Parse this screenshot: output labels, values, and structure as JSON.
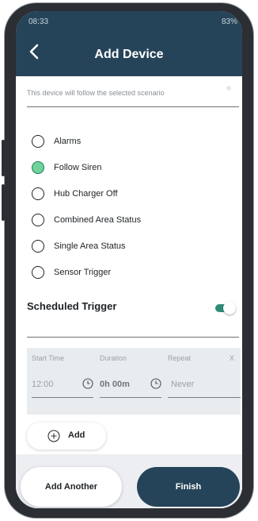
{
  "status_bar": {
    "time": "08:33",
    "right": "83%"
  },
  "header": {
    "title": "Add Device"
  },
  "hint": "This device will follow the selected scenario",
  "options": [
    {
      "label": "Alarms",
      "selected": false
    },
    {
      "label": "Follow Siren",
      "selected": true
    },
    {
      "label": "Hub Charger Off",
      "selected": false
    },
    {
      "label": "Combined Area Status",
      "selected": false
    },
    {
      "label": "Single Area Status",
      "selected": false
    },
    {
      "label": "Sensor Trigger",
      "selected": false
    }
  ],
  "scheduled": {
    "title": "Scheduled Trigger",
    "enabled": true
  },
  "schedule": {
    "start_time_label": "Start Time",
    "duration_label": "Duration",
    "repeat_label": "Repeat",
    "remove_label": "X",
    "start_time": "12:00",
    "duration": "0h 00m",
    "repeat": "Never"
  },
  "add_label": "Add",
  "buttons": {
    "add_another": "Add Another",
    "finish": "Finish"
  },
  "colors": {
    "header": "#264459",
    "accent": "#2e8b78",
    "radio_selected": "#6fd39b"
  }
}
